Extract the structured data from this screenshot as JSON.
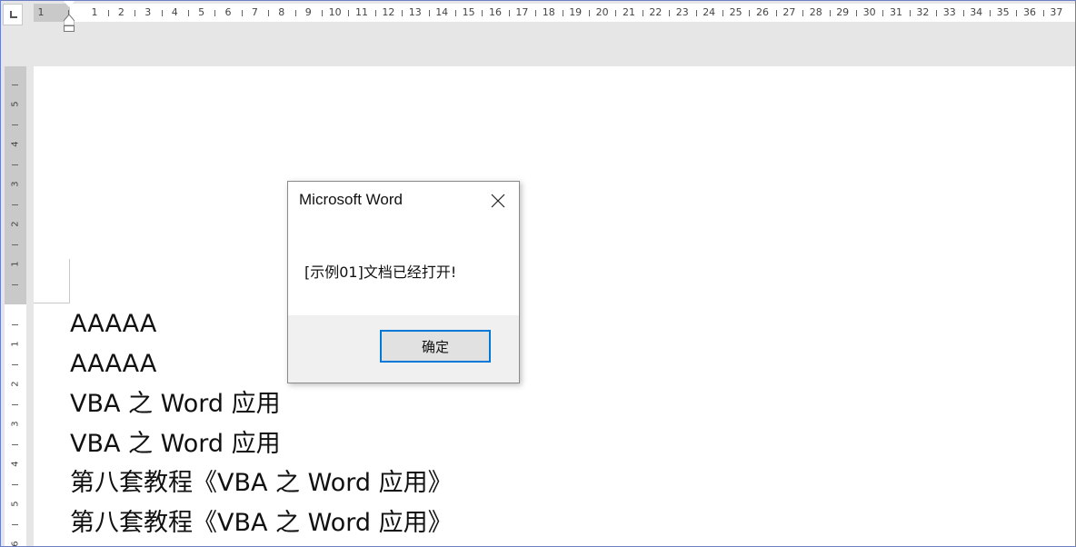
{
  "ruler": {
    "horizontal_numbers": [
      "1",
      "1",
      "2",
      "3",
      "4",
      "5",
      "6",
      "7",
      "8",
      "9",
      "10",
      "11",
      "12",
      "13",
      "14",
      "15",
      "16",
      "17",
      "18",
      "19",
      "20",
      "21",
      "22",
      "23",
      "24",
      "25",
      "26",
      "27",
      "28",
      "29",
      "30",
      "31",
      "32",
      "33",
      "34",
      "35",
      "36",
      "37"
    ],
    "vertical_numbers": [
      "5",
      "4",
      "3",
      "2",
      "1",
      "1",
      "2",
      "3",
      "4",
      "5",
      "6"
    ]
  },
  "document": {
    "lines": [
      "AAAAA",
      "AAAAA",
      "VBA 之 Word 应用",
      "VBA 之 Word 应用",
      "第八套教程《VBA 之 Word 应用》",
      "第八套教程《VBA 之 Word 应用》"
    ]
  },
  "dialog": {
    "title": "Microsoft Word",
    "message": "[示例01]文档已经打开!",
    "ok_label": "确定",
    "close_icon": "close-icon"
  },
  "colors": {
    "accent": "#0078d7",
    "window_border": "#6b7fc4",
    "ruler_bg": "#e6e6e6"
  }
}
